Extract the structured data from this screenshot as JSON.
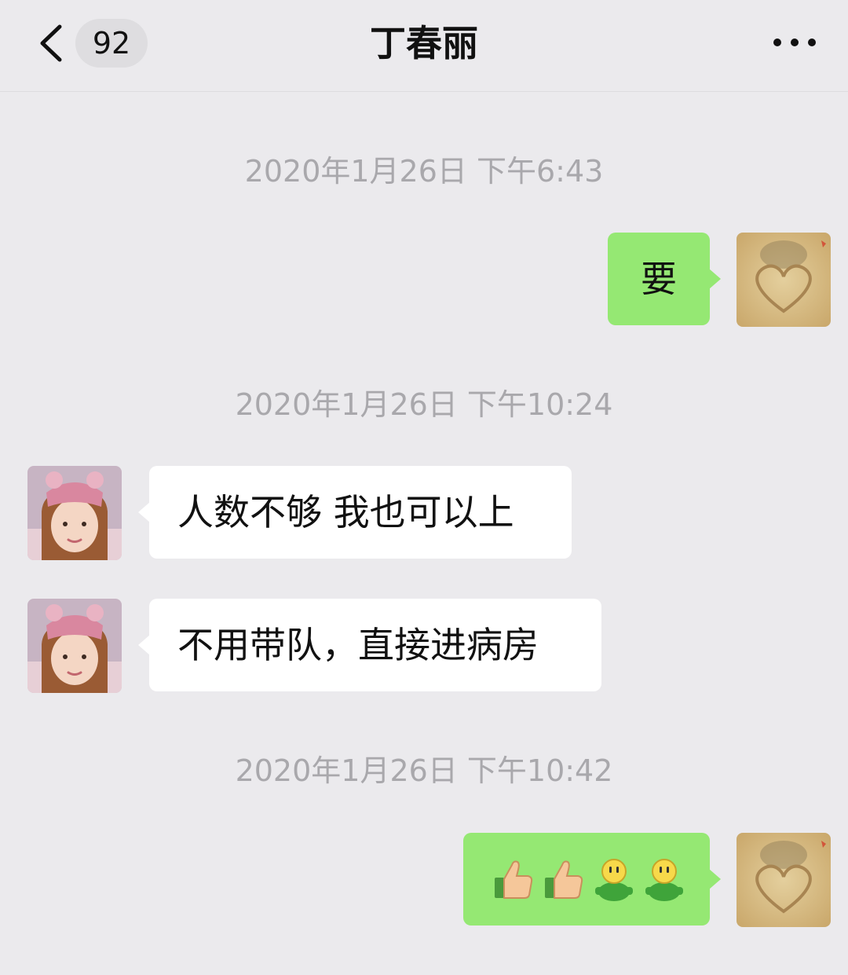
{
  "header": {
    "unread_count": "92",
    "title": "丁春丽"
  },
  "messages": [
    {
      "type": "timestamp",
      "text": "2020年1月26日 下午6:43"
    },
    {
      "type": "sent",
      "text": "要"
    },
    {
      "type": "timestamp",
      "text": "2020年1月26日 下午10:24"
    },
    {
      "type": "received",
      "text": "人数不够 我也可以上"
    },
    {
      "type": "received",
      "text": "不用带队，直接进病房"
    },
    {
      "type": "timestamp",
      "text": "2020年1月26日 下午10:42"
    },
    {
      "type": "sent",
      "emojis": [
        "thumbs-up",
        "thumbs-up",
        "green-doll",
        "green-doll"
      ]
    }
  ],
  "colors": {
    "background": "#ebeaed",
    "sent_bubble": "#95e873",
    "received_bubble": "#ffffff",
    "timestamp_text": "#a9a8ac"
  },
  "icons": {
    "back": "chevron-left-icon",
    "more": "more-dots-icon",
    "self_avatar": "sand-heart-avatar",
    "contact_avatar": "girl-pink-hat-avatar"
  }
}
